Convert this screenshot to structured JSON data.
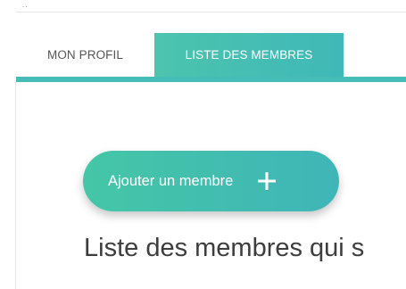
{
  "header": {
    "dots": ".."
  },
  "tabs": [
    {
      "label": "MON PROFIL",
      "active": false
    },
    {
      "label": "LISTE DES MEMBRES",
      "active": true
    }
  ],
  "main": {
    "add_button_label": "Ajouter un membre",
    "add_button_icon": "plus-icon",
    "section_heading": "Liste des membres qui s"
  },
  "colors": {
    "accent": "#46bcb6",
    "gradient_start": "#45c6a6",
    "gradient_end": "#3fb5b8"
  }
}
